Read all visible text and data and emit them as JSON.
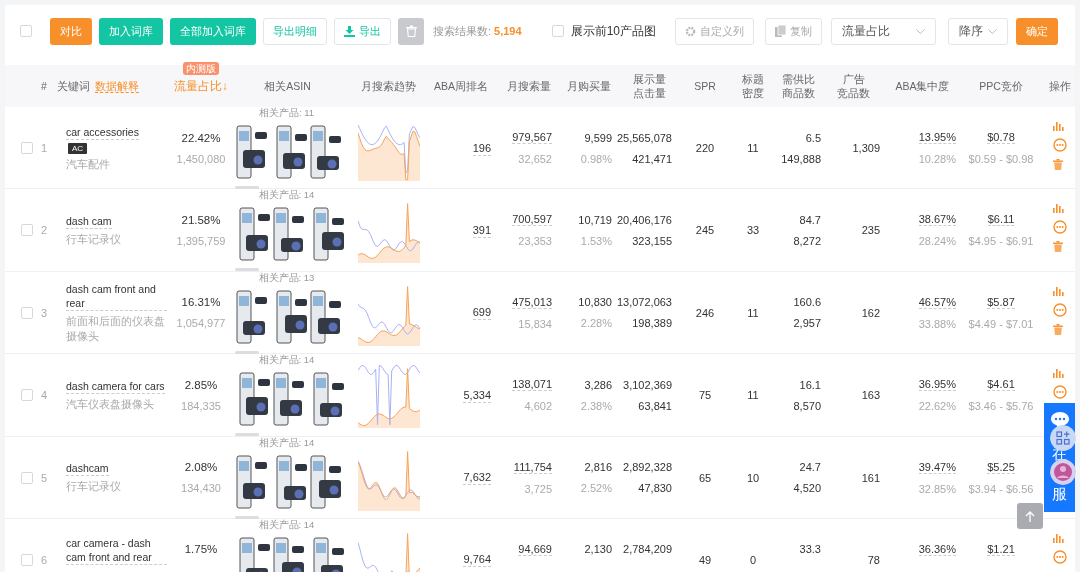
{
  "toolbar": {
    "select_all": {
      "checked": false
    },
    "buttons": [
      {
        "kind": "orange",
        "label": "对比"
      },
      {
        "kind": "green",
        "label": "加入词库"
      },
      {
        "kind": "green",
        "label": "全部加入词库"
      },
      {
        "kind": "outline",
        "label": "导出明细"
      },
      {
        "kind": "download",
        "label": "导出"
      },
      {
        "kind": "trash",
        "disabled": true
      }
    ],
    "result_label": "搜索结果数:",
    "result_count": "5,194",
    "show_images": {
      "label": "展示前10产品图",
      "checked": false
    },
    "custom_columns": {
      "label": "自定义列"
    },
    "copy": {
      "label": "复制"
    },
    "sort_field": {
      "value": "流量占比"
    },
    "sort_order": {
      "value": "降序"
    },
    "confirm": {
      "label": "确定"
    }
  },
  "table": {
    "columns": [
      {
        "lines": [
          "#"
        ]
      },
      {
        "lines": [
          "关键词"
        ],
        "link": "数据解释"
      },
      {
        "lines": [
          "流量占比"
        ],
        "badge": "内测版",
        "sort": "↓",
        "sorted": true
      },
      {
        "lines": [
          "相关ASIN"
        ]
      },
      {
        "lines": [
          "月搜索趋势"
        ]
      },
      {
        "lines": [
          "ABA周排名"
        ]
      },
      {
        "lines": [
          "月搜索量"
        ]
      },
      {
        "lines": [
          "月购买量"
        ]
      },
      {
        "lines": [
          "展示量",
          "点击量"
        ]
      },
      {
        "lines": [
          "SPR"
        ]
      },
      {
        "lines": [
          "标题",
          "密度"
        ]
      },
      {
        "lines": [
          "需供比",
          "商品数"
        ]
      },
      {
        "lines": [
          "广告",
          "竞品数"
        ]
      },
      {
        "lines": [
          "ABA集中度"
        ]
      },
      {
        "lines": [
          "PPC竞价"
        ]
      },
      {
        "lines": [
          "操作"
        ]
      }
    ],
    "rows": [
      {
        "selected": false,
        "index": "1",
        "keyword": "car accessories",
        "badge": "AC",
        "translation": "汽车配件",
        "share": "22.42%",
        "share_count": "1,450,080",
        "related": "相关产品: 11",
        "aba_rank": "196",
        "search_volume": "979,567",
        "search_volume_sub": "32,652",
        "purchases": "9,599",
        "purchase_rate": "0.98%",
        "impressions": "25,565,078",
        "clicks": "421,471",
        "spr": "220",
        "title_density": "11",
        "demand_ratio": "6.5",
        "product_count": "149,888",
        "ad_competitors": "1,309",
        "aba_concentration": "13.95%",
        "aba_concentration_sub": "10.28%",
        "ppc": "$0.78",
        "ppc_range": "$0.59 - $0.98",
        "actions": [
          {
            "kind": "chart"
          },
          {
            "kind": "more"
          },
          {
            "kind": "delete"
          }
        ]
      },
      {
        "selected": false,
        "index": "2",
        "keyword": "dash cam",
        "translation": "行车记录仪",
        "share": "21.58%",
        "share_count": "1,395,759",
        "related": "相关产品: 14",
        "aba_rank": "391",
        "search_volume": "700,597",
        "search_volume_sub": "23,353",
        "purchases": "10,719",
        "purchase_rate": "1.53%",
        "impressions": "20,406,176",
        "clicks": "323,155",
        "spr": "245",
        "title_density": "33",
        "demand_ratio": "84.7",
        "product_count": "8,272",
        "ad_competitors": "235",
        "aba_concentration": "38.67%",
        "aba_concentration_sub": "28.24%",
        "ppc": "$6.11",
        "ppc_range": "$4.95 - $6.91",
        "actions": [
          {
            "kind": "chart"
          },
          {
            "kind": "more"
          },
          {
            "kind": "delete"
          }
        ]
      },
      {
        "selected": false,
        "index": "3",
        "keyword": "dash cam front and rear",
        "translation": "前面和后面的仪表盘摄像头",
        "share": "16.31%",
        "share_count": "1,054,977",
        "related": "相关产品: 13",
        "aba_rank": "699",
        "search_volume": "475,013",
        "search_volume_sub": "15,834",
        "purchases": "10,830",
        "purchase_rate": "2.28%",
        "impressions": "13,072,063",
        "clicks": "198,389",
        "spr": "246",
        "title_density": "11",
        "demand_ratio": "160.6",
        "product_count": "2,957",
        "ad_competitors": "162",
        "aba_concentration": "46.57%",
        "aba_concentration_sub": "33.88%",
        "ppc": "$5.87",
        "ppc_range": "$4.49 - $7.01",
        "actions": [
          {
            "kind": "chart"
          },
          {
            "kind": "more"
          },
          {
            "kind": "delete"
          }
        ]
      },
      {
        "selected": false,
        "index": "4",
        "keyword": "dash camera for cars",
        "translation": "汽车仪表盘摄像头",
        "share": "2.85%",
        "share_count": "184,335",
        "related": "相关产品: 14",
        "aba_rank": "5,334",
        "search_volume": "138,071",
        "search_volume_sub": "4,602",
        "purchases": "3,286",
        "purchase_rate": "2.38%",
        "impressions": "3,102,369",
        "clicks": "63,841",
        "spr": "75",
        "title_density": "11",
        "demand_ratio": "16.1",
        "product_count": "8,570",
        "ad_competitors": "163",
        "aba_concentration": "36.95%",
        "aba_concentration_sub": "22.62%",
        "ppc": "$4.61",
        "ppc_range": "$3.46 - $5.76",
        "actions": [
          {
            "kind": "chart"
          },
          {
            "kind": "more"
          }
        ]
      },
      {
        "selected": false,
        "index": "5",
        "keyword": "dashcam",
        "translation": "行车记录仪",
        "share": "2.08%",
        "share_count": "134,430",
        "related": "相关产品: 14",
        "aba_rank": "7,632",
        "search_volume": "111,754",
        "search_volume_sub": "3,725",
        "purchases": "2,816",
        "purchase_rate": "2.52%",
        "impressions": "2,892,328",
        "clicks": "47,830",
        "spr": "65",
        "title_density": "10",
        "demand_ratio": "24.7",
        "product_count": "4,520",
        "ad_competitors": "161",
        "aba_concentration": "39.47%",
        "aba_concentration_sub": "32.85%",
        "ppc": "$5.25",
        "ppc_range": "$3.94 - $6.56"
      },
      {
        "selected": false,
        "index": "6",
        "keyword": "car camera - dash cam front and rear",
        "share": "1.75%",
        "related": "相关产品: 14",
        "aba_rank": "9,764",
        "search_volume": "94,669",
        "purchases": "2,130",
        "impressions": "2,784,209",
        "spr": "49",
        "title_density": "0",
        "demand_ratio": "33.3",
        "ad_competitors": "78",
        "aba_concentration": "36.36%",
        "ppc": "$1.21",
        "actions": [
          {
            "kind": "chart"
          },
          {
            "kind": "more"
          }
        ]
      }
    ]
  },
  "chat_widget": {
    "chars": [
      "在",
      "服"
    ]
  }
}
